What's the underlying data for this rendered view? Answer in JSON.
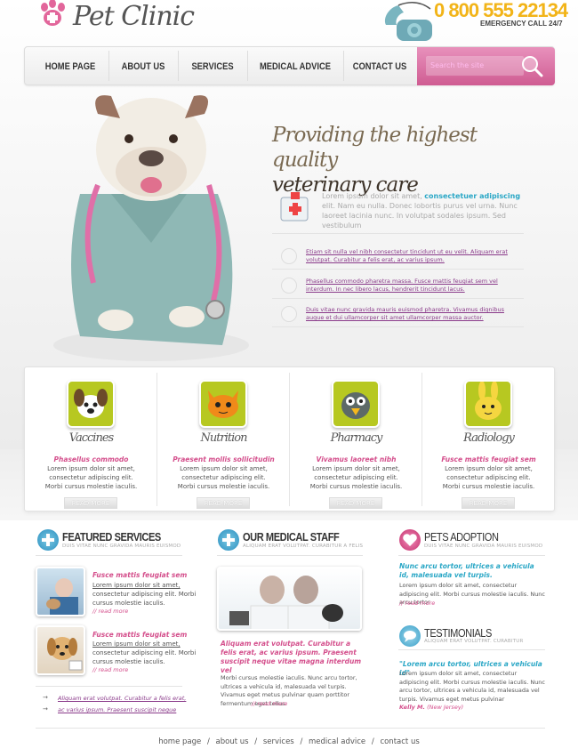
{
  "brand": {
    "name": "Pet Clinic"
  },
  "header": {
    "phone": "0 800 555 22134",
    "emergency": "EMERGENCY CALL 24/7"
  },
  "nav": {
    "items": [
      "HOME PAGE",
      "ABOUT US",
      "SERVICES",
      "MEDICAL ADVICE",
      "CONTACT US"
    ],
    "search_placeholder": "Search the site"
  },
  "hero": {
    "headline1": "Providing the highest quality",
    "headline2": "veterinary care",
    "intro_a": "Lorem ipsum dolor sit amet, ",
    "intro_b": "consectetuer adipiscing",
    "intro_c": " elit. Nam eu nulla. Donec lobortis purus vel urna. Nunc laoreet lacinia nunc. In volutpat sodales ipsum. Sed vestibulum",
    "bullets": [
      "Etiam sit nulla vel nibh consectetur tincidunt ut eu velit. Aliquam erat volutpat. Curabitur a felis erat, ac varius ipsum.",
      "Phasellus commodo pharetra massa. Fusce mattis feugiat sem vel interdum. In nec libero lacus, hendrerit tincidunt lacus.",
      "Duis vitae nunc gravida mauris euismod pharetra. Vivamus dignibus augue et dui ullamcorper sit amet ullamcorper massa auctor."
    ]
  },
  "services": [
    {
      "title": "Vaccines",
      "sub": "Phasellus commodo",
      "desc": "Lorem ipsum dolor sit amet, consectetur adipiscing elit. Morbi cursus molestie iaculis.",
      "more": "READ MORE",
      "color": "#b7c821"
    },
    {
      "title": "Nutrition",
      "sub": "Praesent mollis sollicitudin",
      "desc": "Lorem ipsum dolor sit amet, consectetur adipiscing elit. Morbi cursus molestie iaculis.",
      "more": "READ MORE",
      "color": "#b7c821"
    },
    {
      "title": "Pharmacy",
      "sub": "Vivamus laoreet nibh",
      "desc": "Lorem ipsum dolor sit amet, consectetur adipiscing elit. Morbi cursus molestie iaculis.",
      "more": "READ MORE",
      "color": "#b7c821"
    },
    {
      "title": "Radiology",
      "sub": "Fusce mattis feugiat sem",
      "desc": "Lorem ipsum dolor sit amet, consectetur adipiscing elit. Morbi cursus molestie iaculis.",
      "more": "READ MORE",
      "color": "#b7c821"
    }
  ],
  "featured": {
    "title": "FEATURED SERVICES",
    "sub": "DUIS VITAE NUNC GRAVIDA MAURIS EUISMOD",
    "items": [
      {
        "title": "Fusce mattis feugiat sem",
        "l1": "Lorem ipsum dolor sit amet,",
        "l2": "consectetur adipiscing elit. Morbi",
        "l3": "cursus molestie iaculis.",
        "more": "// read more"
      },
      {
        "title": "Fusce mattis feugiat sem",
        "l1": "Lorem ipsum dolor sit amet,",
        "l2": "consectetur adipiscing elit. Morbi",
        "l3": "cursus molestie iaculis.",
        "more": "// read more"
      }
    ],
    "links": [
      "Aliquam erat volutpat. Curabitur a felis erat,",
      "ac varius ipsum. Praesent suscipit neque"
    ]
  },
  "staff": {
    "title": "OUR MEDICAL STAFF",
    "sub": "ALIQUAM ERAT VOLUTPAT. CURABITUR A FELIS",
    "pink": "Aliquam erat volutpat. Curabitur a felis erat, ac varius ipsum. Praesent suscipit neque vitae magna interdum vel",
    "body": "Morbi cursus molestie iaculis. Nunc arcu tortor, ultrices a vehicula id, malesuada vel turpis. Vivamus eget metus pulvinar quam porttitor fermentum eget tellus.",
    "more": "// read more"
  },
  "adoption": {
    "title": "PETS ADOPTION",
    "sub": "DUIS VITAE NUNC GRAVIDA MAURIS EUISMOD",
    "teal": "Nunc arcu tortor, ultrices a vehicula id, malesuada vel turpis.",
    "body": "Lorem ipsum dolor sit amet, consectetur adipiscing elit. Morbi cursus molestie iaculis. Nunc arcu tortor",
    "more": "// read more"
  },
  "testimonials": {
    "title": "TESTIMONIALS",
    "sub": "ALIQUAM ERAT VOLUTPAT. CURABITUR",
    "quote": "\"Lorem arcu tortor, ultrices a vehicula id\"",
    "body": "Lorem ipsum dolor sit amet, consectetur adipiscing elit. Morbi cursus molestie iaculis. Nunc arcu tortor, ultrices a vehicula id, malesuada vel turpis. Vivamus eget metus pulvinar",
    "author": "Kelly M.",
    "location": "(New Jersey)"
  },
  "footer": {
    "links": [
      "home page",
      "about us",
      "services",
      "medical advice",
      "contact us"
    ],
    "sep": "/"
  },
  "colors": {
    "pink": "#d44f8c",
    "teal": "#2aa7c6",
    "gold": "#f2b418",
    "lime": "#b7c821"
  }
}
